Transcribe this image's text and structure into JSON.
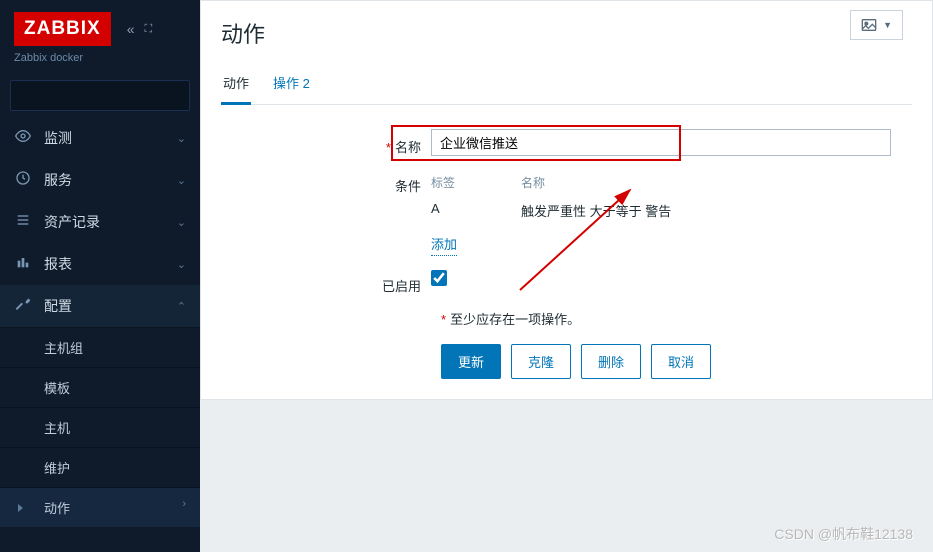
{
  "brand": "ZABBIX",
  "subtitle": "Zabbix docker",
  "nav": {
    "items": [
      {
        "label": "监测",
        "icon": "◉"
      },
      {
        "label": "服务",
        "icon": "◷"
      },
      {
        "label": "资产记录",
        "icon": "≡"
      },
      {
        "label": "报表",
        "icon": "▯"
      },
      {
        "label": "配置",
        "icon": "🔧"
      }
    ],
    "config_sub": [
      {
        "label": "主机组"
      },
      {
        "label": "模板"
      },
      {
        "label": "主机"
      },
      {
        "label": "维护"
      },
      {
        "label": "动作"
      }
    ]
  },
  "page": {
    "title": "动作",
    "tabs": [
      {
        "label": "动作"
      },
      {
        "label": "操作 2"
      }
    ],
    "form": {
      "name_label": "名称",
      "name_value": "企业微信推送",
      "conditions_label": "条件",
      "cond_header_label": "标签",
      "cond_header_name": "名称",
      "cond_rows": [
        {
          "label": "A",
          "name": "触发严重性 大于等于 警告"
        }
      ],
      "add_link": "添加",
      "enabled_label": "已启用",
      "enabled_value": true,
      "warning": "至少应存在一项操作。",
      "buttons": {
        "update": "更新",
        "clone": "克隆",
        "delete": "删除",
        "cancel": "取消"
      }
    }
  },
  "watermark": "CSDN @帆布鞋12138"
}
